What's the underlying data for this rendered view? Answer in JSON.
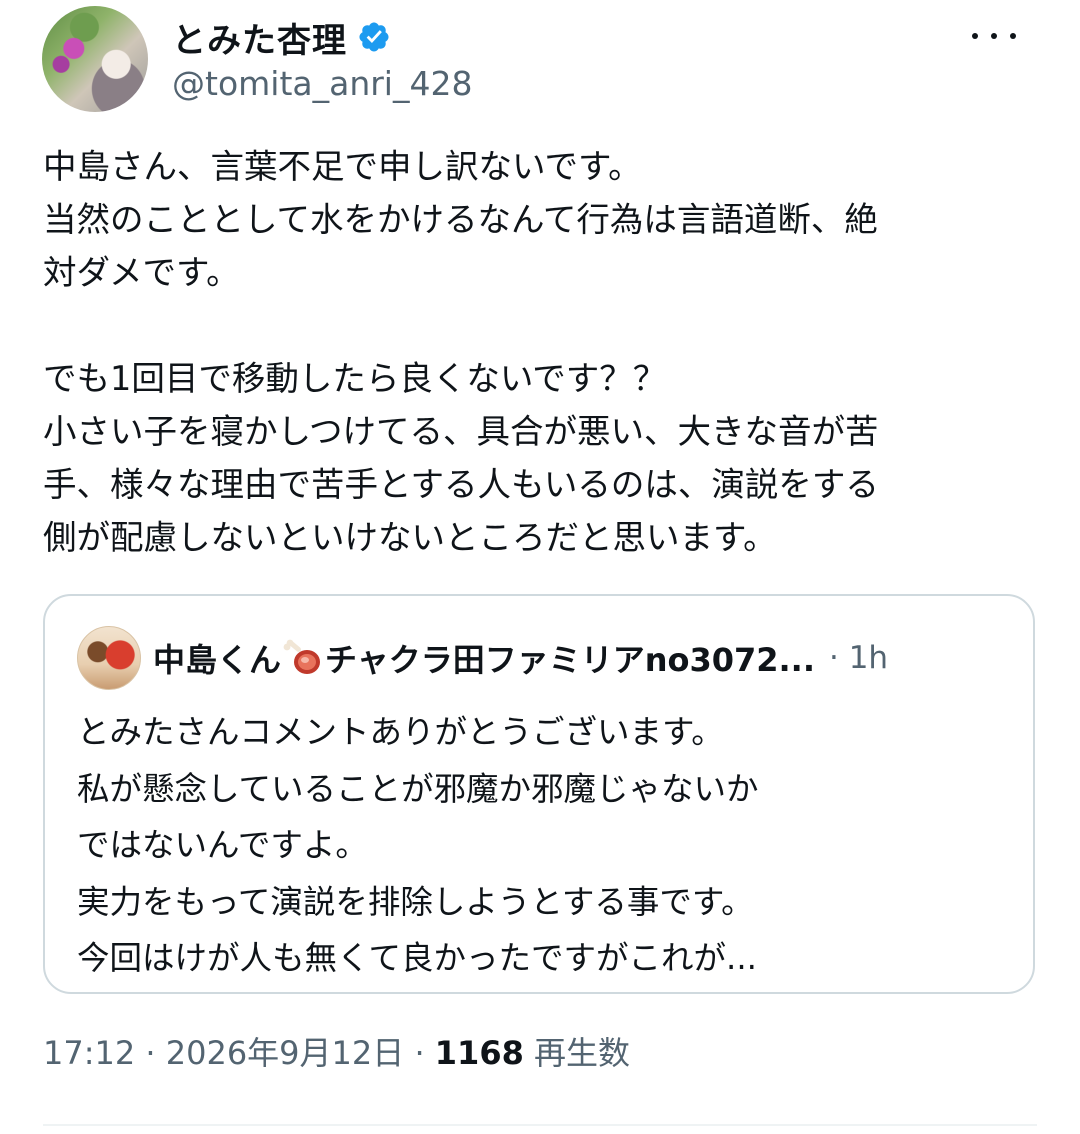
{
  "author": {
    "display_name": "とみた杏理",
    "handle": "@tomita_anri_428",
    "verified_icon": "verified-badge-icon",
    "more_icon": "more-horizontal-icon"
  },
  "tweet": {
    "lines": [
      "中島さん、言葉不足で申し訳ないです。",
      "当然のこととして水をかけるなんて行為は言語道断、絶",
      "対ダメです。",
      "",
      "でも1回目で移動したら良くないです？？",
      "小さい子を寝かしつけてる、具合が悪い、大きな音が苦",
      "手、様々な理由で苦手とする人もいるのは、演説をする",
      "側が配慮しないといけないところだと思います。"
    ]
  },
  "quoted": {
    "name_part1": "中島くん",
    "emoji": "meat-on-bone-icon",
    "name_part2": "チャクラ田ファミリアno3072...",
    "time": "· 1h",
    "lines": [
      "とみたさんコメントありがとうございます。",
      "私が懸念していることが邪魔か邪魔じゃないか",
      "ではないんですよ。",
      "実力をもって演説を排除しようとする事です。",
      "今回はけが人も無くて良かったですがこれが..."
    ]
  },
  "meta": {
    "time": "17:12",
    "sep1": " · ",
    "date": "2026年9月12日",
    "sep2": " · ",
    "views": "1168",
    "views_label": " 再生数"
  },
  "colors": {
    "text": "#0f1419",
    "secondary": "#536471",
    "verified": "#1d9bf0",
    "border": "#cfd9de"
  }
}
